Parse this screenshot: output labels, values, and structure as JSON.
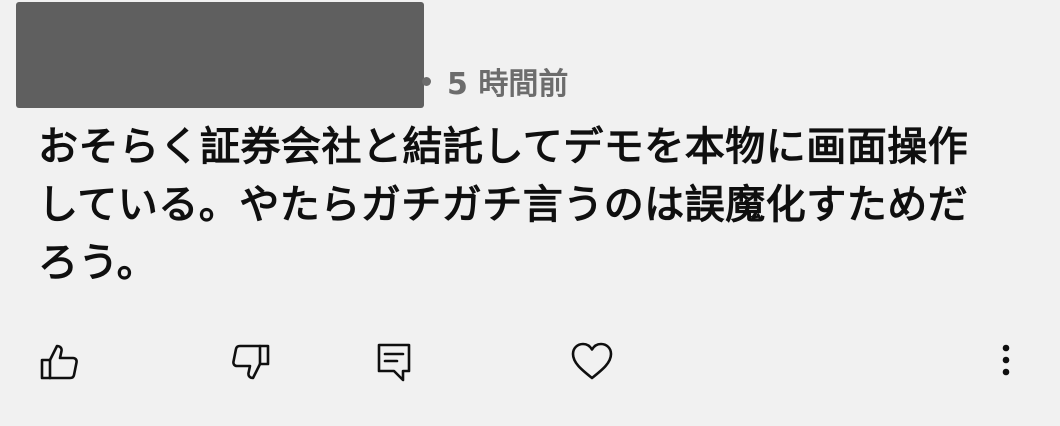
{
  "comment": {
    "timestamp": "5 時間前",
    "text": "おそらく証券会社と結託してデモを本物に画面操作\nしている。やたらガチガチ言うのは誤魔化すためだ\nろう。"
  },
  "actions": {
    "icons": [
      "thumbs-up-icon",
      "thumbs-down-icon",
      "reply-icon",
      "heart-icon",
      "more-vert-icon"
    ]
  },
  "colors": {
    "background": "#f1f1f1",
    "text": "#0f0f0f",
    "meta": "#6c6c6c",
    "redaction": "#5f5f5f"
  }
}
